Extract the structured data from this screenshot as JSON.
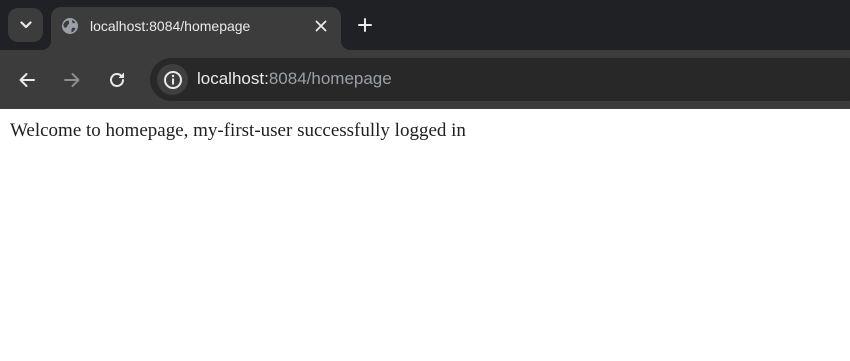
{
  "browser": {
    "tab": {
      "title": "localhost:8084/homepage",
      "favicon": "globe-icon"
    },
    "toolbar": {
      "back_icon": "arrow-left-icon",
      "forward_icon": "arrow-right-icon",
      "reload_icon": "reload-icon"
    },
    "omnibox": {
      "site_info_icon": "info-icon",
      "url_host": "localhost:",
      "url_rest": "8084/homepage"
    },
    "colors": {
      "tabstrip": "#202124",
      "toolbar": "#3c3c3c",
      "omnibox": "#282828"
    }
  },
  "page": {
    "welcome_message": "Welcome to homepage, my-first-user successfully logged in"
  }
}
